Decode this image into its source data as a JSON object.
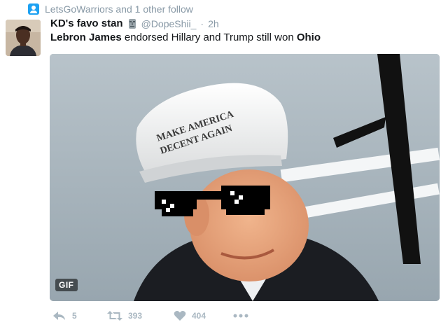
{
  "social_context": {
    "icon": "follow-person-icon",
    "text": "LetsGoWarriors and 1 other follow"
  },
  "author": {
    "name": "KD's favo stan",
    "name_emoji": "moai-icon",
    "handle": "@DopeShii_",
    "separator": "·",
    "time": "2h"
  },
  "tweet": {
    "part1": "Lebron James",
    "part2": " endorsed Hillary and Trump still won ",
    "part3": "Ohio"
  },
  "media": {
    "type_badge": "GIF",
    "hat_line1": "MAKE AMERICA",
    "hat_line2": "DECENT AGAIN"
  },
  "actions": {
    "reply_count": "5",
    "retweet_count": "393",
    "like_count": "404"
  },
  "colors": {
    "text_primary": "#14171a",
    "text_muted": "#8899a6",
    "action_gray": "#aab8c2",
    "link_blue": "#1da1f2"
  }
}
